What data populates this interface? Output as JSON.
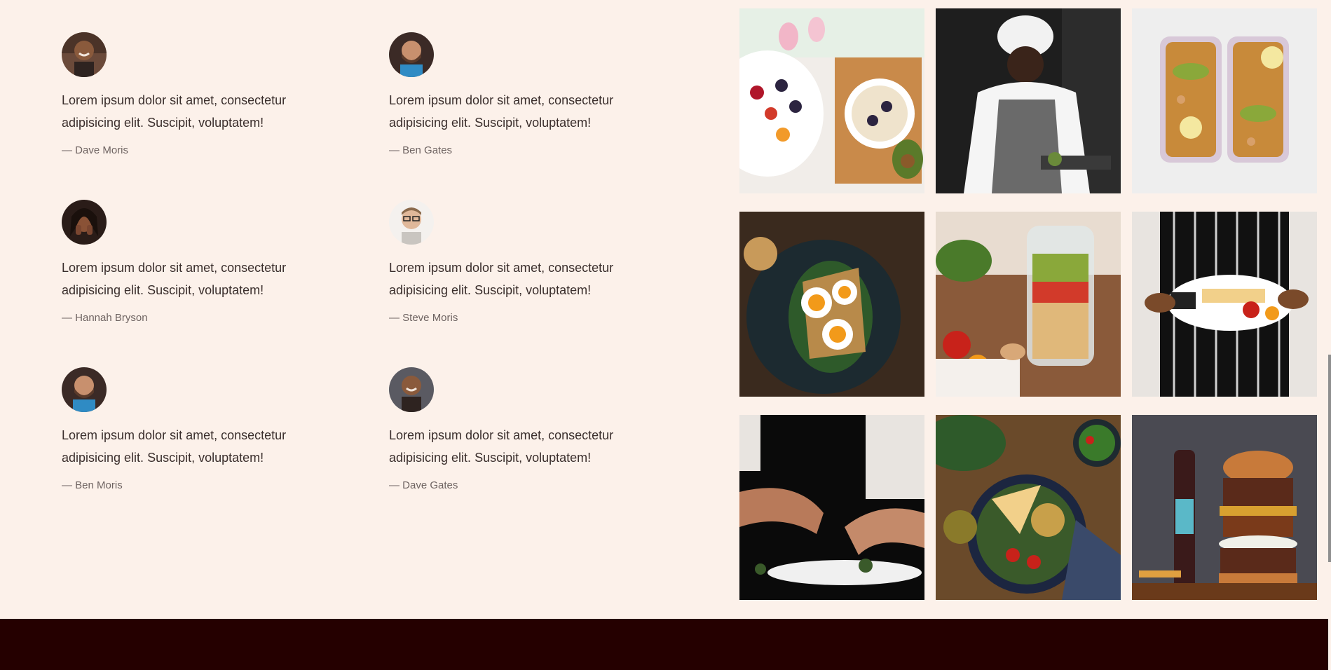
{
  "testimonials": [
    {
      "quote": "Lorem ipsum dolor sit amet, consectetur adipisicing elit. Suscipit, voluptatem!",
      "author": "— Dave Moris",
      "avatar_icon": "person-smiling-man-avatar"
    },
    {
      "quote": "Lorem ipsum dolor sit amet, consectetur adipisicing elit. Suscipit, voluptatem!",
      "author": "— Ben Gates",
      "avatar_icon": "person-bearded-man-avatar"
    },
    {
      "quote": "Lorem ipsum dolor sit amet, consectetur adipisicing elit. Suscipit, voluptatem!",
      "author": "— Hannah Bryson",
      "avatar_icon": "person-woman-avatar"
    },
    {
      "quote": "Lorem ipsum dolor sit amet, consectetur adipisicing elit. Suscipit, voluptatem!",
      "author": "— Steve Moris",
      "avatar_icon": "person-glasses-man-avatar"
    },
    {
      "quote": "Lorem ipsum dolor sit amet, consectetur adipisicing elit. Suscipit, voluptatem!",
      "author": "— Ben Moris",
      "avatar_icon": "person-bearded-man-avatar"
    },
    {
      "quote": "Lorem ipsum dolor sit amet, consectetur adipisicing elit. Suscipit, voluptatem!",
      "author": "— Dave Gates",
      "avatar_icon": "person-smiling-man-avatar"
    }
  ],
  "gallery": [
    {
      "icon": "fruit-bowl-photo"
    },
    {
      "icon": "chef-cooking-photo"
    },
    {
      "icon": "meal-prep-box-photo"
    },
    {
      "icon": "egg-avocado-toast-photo"
    },
    {
      "icon": "salad-jar-photo"
    },
    {
      "icon": "chef-holding-plate-photo"
    },
    {
      "icon": "chef-plating-photo"
    },
    {
      "icon": "buddha-bowl-photo"
    },
    {
      "icon": "burger-stack-photo"
    }
  ],
  "colors": {
    "background": "#fcf1ea",
    "footer": "#250000",
    "text": "#3a2e2c",
    "author_text": "#6e6361"
  }
}
